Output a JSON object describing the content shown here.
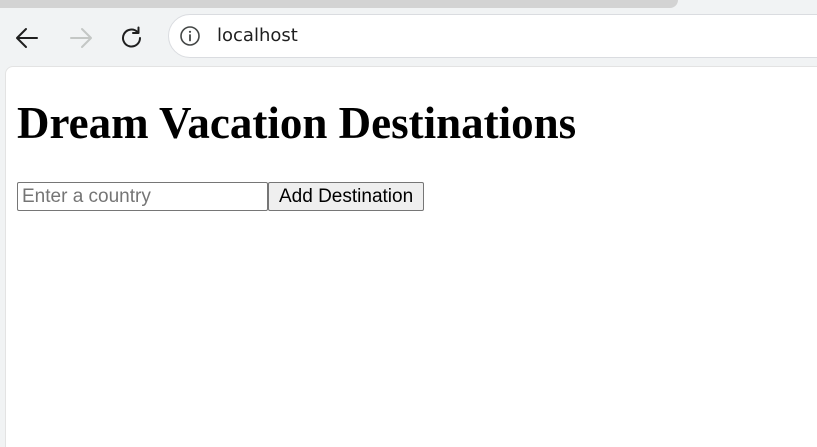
{
  "browser": {
    "url": "localhost",
    "icons": {
      "back": "back-arrow-icon",
      "forward": "forward-arrow-icon",
      "reload": "reload-icon",
      "site_info": "info-icon"
    },
    "forward_enabled": false
  },
  "page": {
    "title": "Dream Vacation Destinations",
    "country_input": {
      "value": "",
      "placeholder": "Enter a country"
    },
    "add_button_label": "Add Destination"
  },
  "colors": {
    "toolbar_bg": "#f1f3f4",
    "page_bg": "#ffffff",
    "disabled_icon": "#c4c7c5",
    "icon": "#1f1f1f"
  }
}
